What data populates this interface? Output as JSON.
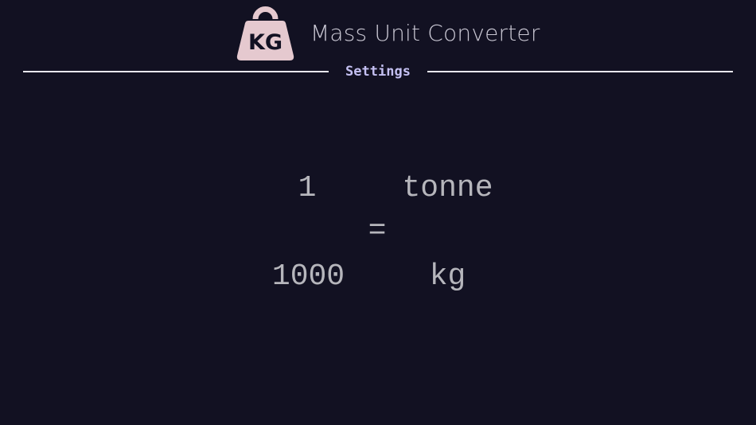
{
  "header": {
    "logo_text": "KG",
    "title": "Mass Unit Converter",
    "settings_label": "Settings"
  },
  "conversion": {
    "from_value": "1",
    "from_unit": "tonne",
    "equals_sign": "=",
    "to_value": "1000",
    "to_unit": "kg"
  },
  "colors": {
    "background": "#121122",
    "logo": "#e5c9cf",
    "accent": "#c4c0f2",
    "text": "#b6b6bc"
  }
}
